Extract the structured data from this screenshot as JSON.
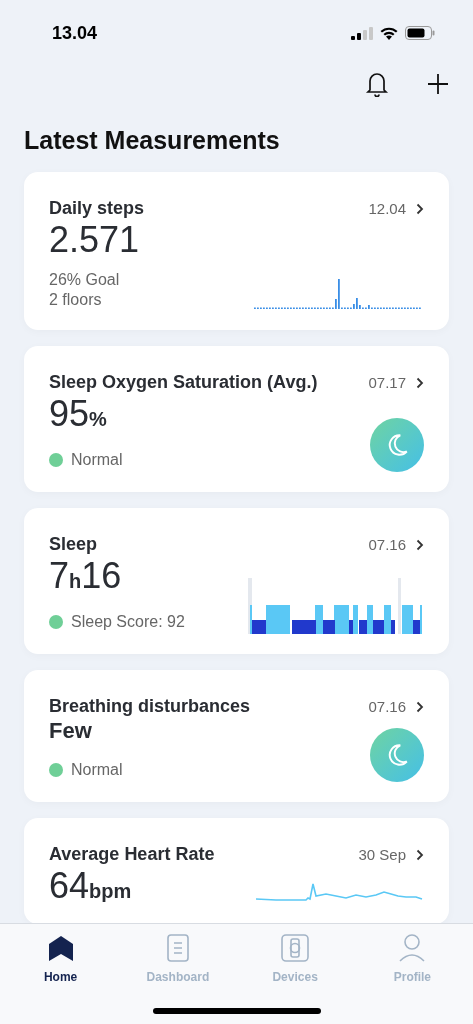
{
  "status_bar": {
    "time": "13.04"
  },
  "header": {
    "title": "Latest Measurements"
  },
  "cards": [
    {
      "kind": "bars",
      "title": "Daily steps",
      "date": "12.04",
      "value": [
        {
          "text": "2.571",
          "kind": "number"
        }
      ],
      "lines": [
        "26% Goal",
        "2 floors"
      ]
    },
    {
      "kind": "moon",
      "title": "Sleep Oxygen Saturation (Avg.)",
      "date": "07.17",
      "value": [
        {
          "text": "95",
          "kind": "number"
        },
        {
          "text": "%",
          "kind": "unit"
        }
      ],
      "status": {
        "text": "Normal",
        "color": "#6fcf97"
      }
    },
    {
      "kind": "hypnogram",
      "title": "Sleep",
      "date": "07.16",
      "value": [
        {
          "text": "7",
          "kind": "number"
        },
        {
          "text": "h",
          "kind": "unit"
        },
        {
          "text": "16",
          "kind": "number"
        }
      ],
      "status": {
        "text": "Sleep Score: 92",
        "color": "#6fcf97"
      }
    },
    {
      "kind": "moon",
      "title": "Breathing disturbances",
      "date": "07.16",
      "value": [
        {
          "text": "Few",
          "kind": "word"
        }
      ],
      "status": {
        "text": "Normal",
        "color": "#6fcf97"
      }
    },
    {
      "kind": "line",
      "title": "Average Heart Rate",
      "date": "30 Sep",
      "value": [
        {
          "text": "64",
          "kind": "number"
        },
        {
          "text": "bpm",
          "kind": "unit"
        }
      ]
    }
  ],
  "tab_bar": [
    {
      "label": "Home",
      "kind": "home",
      "selected": true
    },
    {
      "label": "Dashboard",
      "kind": "doc",
      "selected": false
    },
    {
      "label": "Devices",
      "kind": "watch",
      "selected": false
    },
    {
      "label": "Profile",
      "kind": "person",
      "selected": false
    }
  ]
}
